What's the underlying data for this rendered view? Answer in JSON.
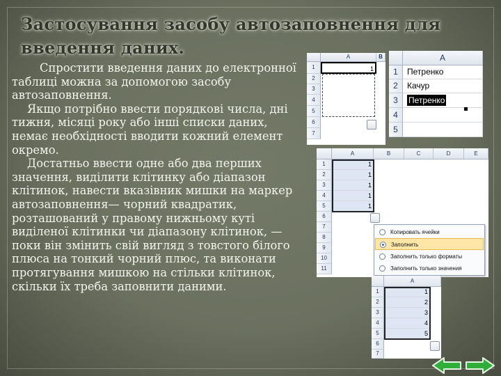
{
  "title": "Застосування засобу автозаповнення  для введення даних.",
  "paragraphs": [
    "Спростити  введення даних до електронної таблиці можна за допомогою засобу автозаповнення.",
    "Якщо потрібно ввести порядкові числа, дні тижня, місяці року або інші списки даних, немає необхідності вводити кожний елемент окремо.",
    "Достатньо ввести одне або два перших значення, виділити клітинку або діапазон клітинок, навести вказівник мишки на маркер автозаповнення— чорний квадратик, розташований у правому нижньому куті виділеної клітинки чи діапазону клітинок, — поки він змінить свій вигляд з товстого білого плюса на тонкий чорний плюс, та виконати протягування мишкою на стільки клітинок, скільки їх треба заповнити даними."
  ],
  "sheet1": {
    "col_a": "A",
    "col_b": "B",
    "rows": [
      "1",
      "2",
      "3",
      "4",
      "5",
      "6",
      "7"
    ],
    "cell_a1": "1"
  },
  "sheet2": {
    "col_a": "A",
    "rows": [
      "1",
      "2",
      "3",
      "4",
      "5"
    ],
    "cells": [
      "Петренко",
      "Качур",
      "Петренко",
      "",
      ""
    ]
  },
  "sheet3": {
    "cols": [
      "A",
      "B",
      "C",
      "D",
      "E"
    ],
    "rows": [
      "1",
      "2",
      "3",
      "4",
      "5",
      "6",
      "7",
      "8",
      "9",
      "10",
      "11"
    ],
    "values": [
      "1",
      "1",
      "1",
      "1",
      "1"
    ],
    "menu": [
      "Копировать ячейки",
      "Заполнить",
      "Заполнить только форматы",
      "Заполнить только значения"
    ],
    "menu_selected": 1
  },
  "sheet4": {
    "col_a": "A",
    "rows": [
      "1",
      "2",
      "3",
      "4",
      "5",
      "6",
      "7"
    ],
    "values": [
      "1",
      "2",
      "3",
      "4",
      "5"
    ]
  },
  "colors": {
    "nav_arrow": "#2fae3a",
    "highlight": "#fde6a8",
    "background": "#6f7463"
  }
}
